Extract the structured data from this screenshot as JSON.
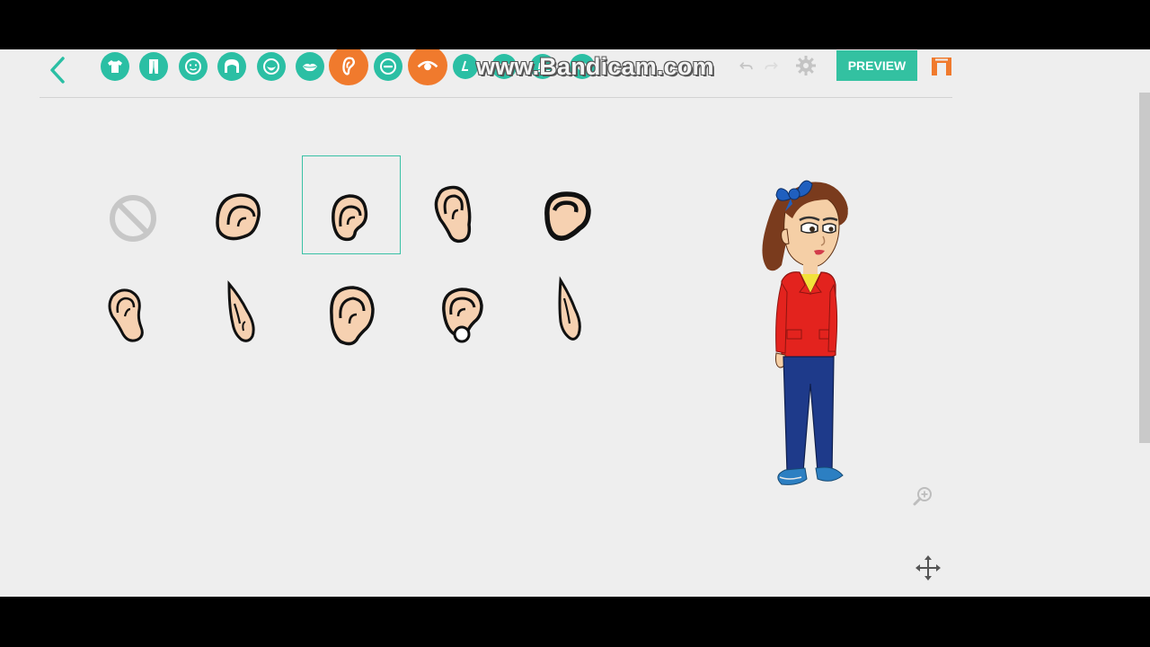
{
  "toolbar": {
    "preview_label": "PREVIEW",
    "watermark_text": "www.Bandicam.com",
    "accent_color": "#2bbfa4",
    "active_color": "#f07a2d",
    "categories": [
      {
        "name": "shirt-icon"
      },
      {
        "name": "pants-icon"
      },
      {
        "name": "face-icon"
      },
      {
        "name": "hair-icon"
      },
      {
        "name": "beard-icon"
      },
      {
        "name": "mouth-icon"
      },
      {
        "name": "ear-icon",
        "active": true
      },
      {
        "name": "eyebrow-icon"
      },
      {
        "name": "eye-icon"
      }
    ]
  },
  "items": [
    {
      "name": "none-option",
      "icon": "no-symbol-icon"
    },
    {
      "name": "ear-option-round",
      "icon": "ear-icon"
    },
    {
      "name": "ear-option-small",
      "icon": "ear-icon",
      "selected": true
    },
    {
      "name": "ear-option-tall",
      "icon": "ear-icon"
    },
    {
      "name": "ear-option-bold",
      "icon": "ear-icon"
    },
    {
      "name": "ear-option-narrow",
      "icon": "ear-icon"
    },
    {
      "name": "ear-option-elf",
      "icon": "ear-icon"
    },
    {
      "name": "ear-option-large",
      "icon": "ear-icon"
    },
    {
      "name": "ear-option-earring",
      "icon": "ear-icon"
    },
    {
      "name": "ear-option-elf-long",
      "icon": "ear-icon"
    }
  ],
  "stage": {
    "character": "character-preview",
    "controls": [
      "zoom-in-icon",
      "move-icon"
    ]
  }
}
